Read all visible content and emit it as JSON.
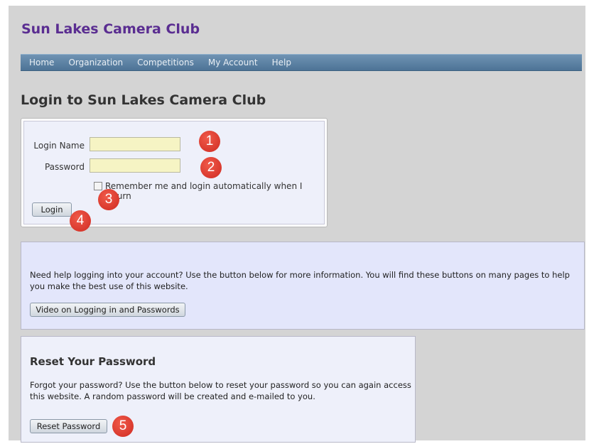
{
  "site": {
    "title": "Sun Lakes Camera Club"
  },
  "nav": {
    "items": [
      "Home",
      "Organization",
      "Competitions",
      "My Account",
      "Help"
    ]
  },
  "page": {
    "heading": "Login to Sun Lakes Camera Club"
  },
  "login": {
    "login_name_label": "Login Name",
    "login_name_value": "",
    "password_label": "Password",
    "password_value": "",
    "remember_label": "Remember me and login automatically when I return",
    "remember_checked": false,
    "login_button": "Login"
  },
  "callouts": [
    "1",
    "2",
    "3",
    "4",
    "5"
  ],
  "help": {
    "text": "Need help logging into your account? Use the button below for more information. You will find these buttons on many pages to help you make the best use of this website.",
    "video_button": "Video on Logging in and Passwords"
  },
  "reset": {
    "title": "Reset Your Password",
    "text": "Forgot your password? Use the button below to reset your password so you can again access this website. A random password will be created and e-mailed to you.",
    "button": "Reset Password"
  },
  "colors": {
    "site_title": "#5a2d91",
    "navbar": "#4d7396",
    "input_fill": "#f6f4c4",
    "callout": "#cf2a21"
  }
}
